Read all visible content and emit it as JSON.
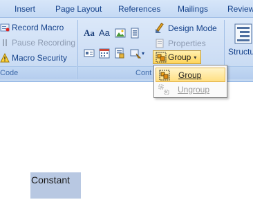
{
  "tabs": [
    "Insert",
    "Page Layout",
    "References",
    "Mailings",
    "Review"
  ],
  "code_group": {
    "label": "Code",
    "record_macro": "Record Macro",
    "pause_recording": "Pause Recording",
    "macro_security": "Macro Security"
  },
  "controls_group": {
    "label": "Cont",
    "rich_text_label": "Aa",
    "plain_text_label": "Aa",
    "design_mode": "Design Mode",
    "properties": "Properties",
    "group": "Group"
  },
  "structure_label": "Structu",
  "group_menu": {
    "group": "Group",
    "ungroup": "Ungroup"
  },
  "document": {
    "text": "Constant"
  }
}
